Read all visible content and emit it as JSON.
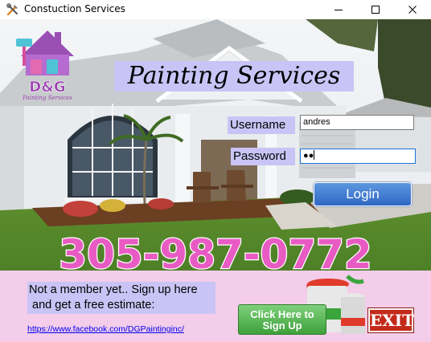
{
  "window": {
    "title": "Constuction Services",
    "icon": "tools-icon"
  },
  "logo": {
    "initials": "D&G",
    "tagline": "Painting Services",
    "icon": "paint-roller-house-icon"
  },
  "header": {
    "title": "Painting Services"
  },
  "login": {
    "username_label": "Username",
    "username_value": "andres",
    "password_label": "Password",
    "password_mask": "●●",
    "login_label": "Login"
  },
  "promo": {
    "phone": "305-987-0772",
    "member_text_line1": "Not a member yet.. Sign up here",
    "member_text_line2": " and get a free estimate:",
    "facebook_url": "https://www.facebook.com/DGPaintinginc/",
    "signup_line1": "Click Here to",
    "signup_line2": "Sign Up",
    "exit_label": "EXIT"
  },
  "colors": {
    "label_bg": "#c9c4f5",
    "phone_text": "#e85bc3",
    "strip_bg": "#f3cdea",
    "login_button": "#3b78d0",
    "signup_button": "#4aa846",
    "exit_button": "#c42a1a"
  }
}
